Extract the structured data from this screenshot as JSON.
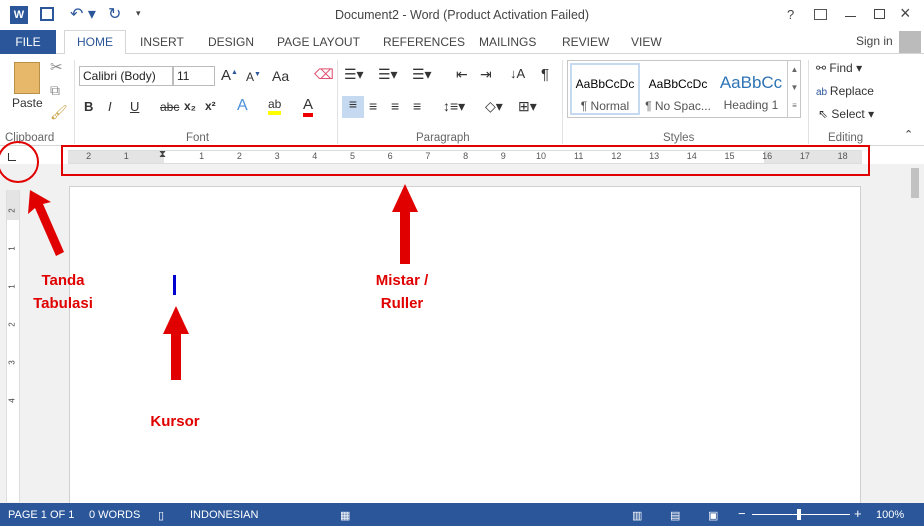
{
  "window": {
    "title": "Document2 - Word (Product Activation Failed)",
    "help": "?",
    "user": "Sign in"
  },
  "tabs": [
    {
      "label": "FILE"
    },
    {
      "label": "HOME"
    },
    {
      "label": "INSERT"
    },
    {
      "label": "DESIGN"
    },
    {
      "label": "PAGE LAYOUT"
    },
    {
      "label": "REFERENCES"
    },
    {
      "label": "MAILINGS"
    },
    {
      "label": "REVIEW"
    },
    {
      "label": "VIEW"
    }
  ],
  "clipboard": {
    "paste": "Paste",
    "group": "Clipboard"
  },
  "font": {
    "name": "Calibri (Body)",
    "size": "11",
    "group": "Font",
    "change_case": "Aa",
    "bold": "B",
    "italic": "I",
    "underline": "U",
    "strike": "abc",
    "sub": "x₂",
    "sup": "x²"
  },
  "paragraph": {
    "group": "Paragraph"
  },
  "styles": {
    "group": "Styles",
    "items": [
      {
        "preview": "AaBbCcDc",
        "label": "¶ Normal"
      },
      {
        "preview": "AaBbCcDc",
        "label": "¶ No Spac..."
      },
      {
        "preview": "AaBbCc",
        "label": "Heading 1"
      }
    ]
  },
  "editing": {
    "group": "Editing",
    "find": "Find",
    "replace": "Replace",
    "select": "Select"
  },
  "ruler": {
    "left": [
      "2",
      "1"
    ],
    "right": [
      "1",
      "2",
      "3",
      "4",
      "5",
      "6",
      "7",
      "8",
      "9",
      "10",
      "11",
      "12",
      "13",
      "14",
      "15",
      "16",
      "17",
      "18"
    ]
  },
  "vruler": [
    "2",
    "1",
    "1",
    "2",
    "3",
    "4"
  ],
  "annotations": {
    "tab": "Tanda Tabulasi",
    "ruler": "Mistar / Ruller",
    "cursor": "Kursor",
    "color": "#e00000"
  },
  "status": {
    "page": "PAGE 1 OF 1",
    "words": "0 WORDS",
    "language": "INDONESIAN",
    "zoom": "100%"
  },
  "colors": {
    "accent": "#2b579a"
  }
}
